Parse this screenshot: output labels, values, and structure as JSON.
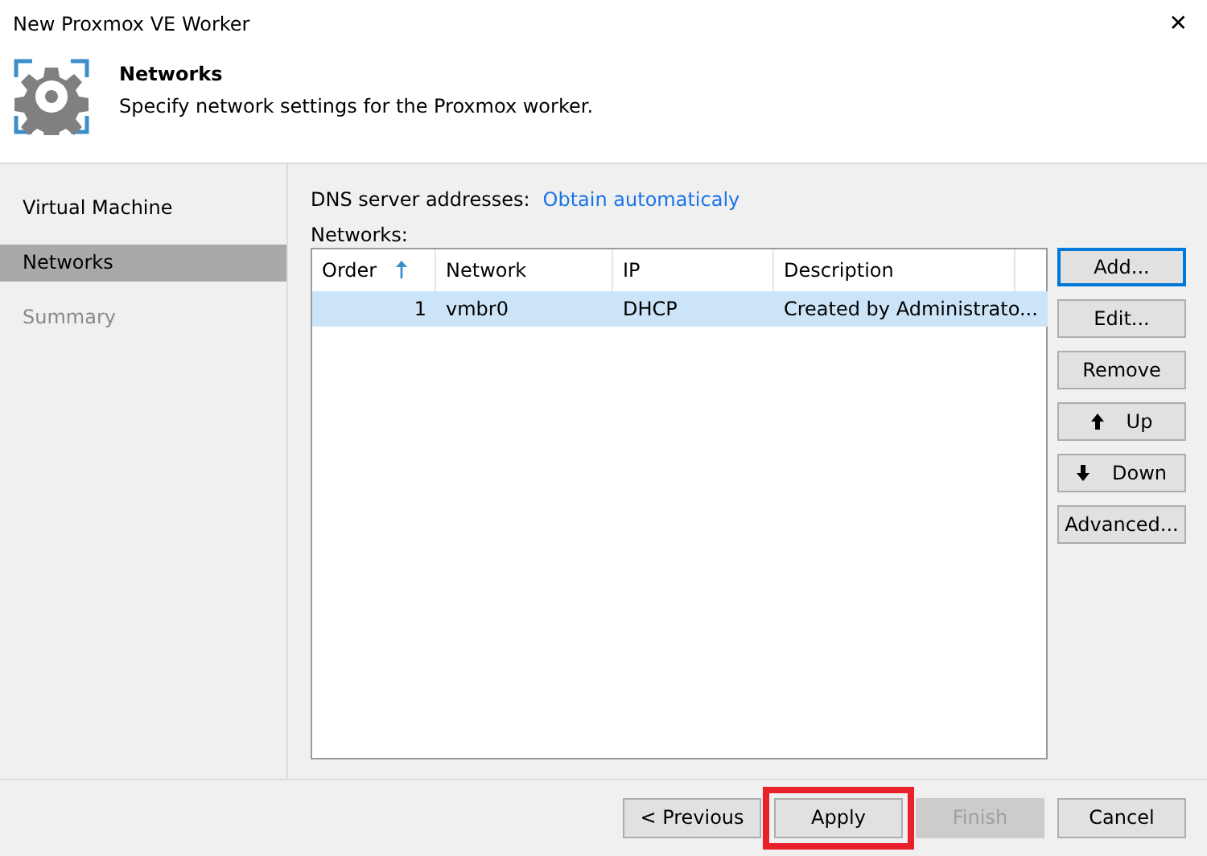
{
  "window": {
    "title": "New Proxmox VE Worker",
    "close": "✕"
  },
  "header": {
    "title": "Networks",
    "subtitle": "Specify network settings for the Proxmox worker."
  },
  "sidebar": {
    "items": [
      {
        "label": "Virtual Machine",
        "selected": false,
        "disabled": false
      },
      {
        "label": "Networks",
        "selected": true,
        "disabled": false
      },
      {
        "label": "Summary",
        "selected": false,
        "disabled": true
      }
    ]
  },
  "dns": {
    "label": "DNS server addresses:",
    "link": "Obtain automaticaly"
  },
  "networks": {
    "label": "Networks:",
    "columns": [
      {
        "label": "Order",
        "sorted": true
      },
      {
        "label": "Network",
        "sorted": false
      },
      {
        "label": "IP",
        "sorted": false
      },
      {
        "label": "Description",
        "sorted": false
      }
    ],
    "rows": [
      {
        "cells": [
          "1",
          "vmbr0",
          "DHCP",
          "Created by Administrato..."
        ],
        "selected": true
      }
    ]
  },
  "side_buttons": [
    {
      "label": "Add...",
      "kind": "plain",
      "focused": true
    },
    {
      "label": "Edit...",
      "kind": "plain",
      "focused": false
    },
    {
      "label": "Remove",
      "kind": "plain",
      "focused": false
    },
    {
      "label": "Up",
      "kind": "up",
      "focused": false
    },
    {
      "label": "Down",
      "kind": "down",
      "focused": false
    },
    {
      "label": "Advanced...",
      "kind": "plain",
      "focused": false
    }
  ],
  "footer_buttons": [
    {
      "label": "< Previous",
      "disabled": false,
      "highlighted": false
    },
    {
      "label": "Apply",
      "disabled": false,
      "highlighted": true
    },
    {
      "label": "Finish",
      "disabled": true,
      "highlighted": false
    },
    {
      "label": "Cancel",
      "disabled": false,
      "highlighted": false
    }
  ]
}
